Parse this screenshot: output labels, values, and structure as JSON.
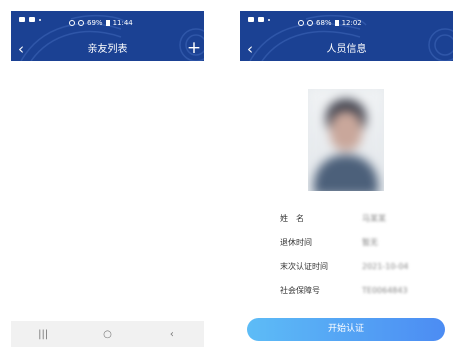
{
  "left_screen": {
    "status": {
      "icons": "⊟ ▣ •  ⏰ ᯤ ⁿ ᵢₗ 69% ▮ 11:44",
      "battery": "69%",
      "time": "11:44"
    },
    "nav": {
      "title": "亲友列表",
      "back_glyph": "‹",
      "add_glyph": "+"
    },
    "android_nav": {
      "recents": "|||",
      "home": "○",
      "back": "‹"
    }
  },
  "right_screen": {
    "status": {
      "battery": "68%",
      "time": "12:02"
    },
    "nav": {
      "title": "人员信息",
      "back_glyph": "‹"
    },
    "info": [
      {
        "label": "姓　名",
        "value": "马某某"
      },
      {
        "label": "退休时间",
        "value": "暂无"
      },
      {
        "label": "末次认证时间",
        "value": "2021-10-04"
      },
      {
        "label": "社会保障号",
        "value": "TE0064843"
      }
    ],
    "start_button": "开始认证"
  },
  "colors": {
    "header": "#1b4193",
    "button_start": "#5dbcf6",
    "button_end": "#4c8cf3"
  }
}
